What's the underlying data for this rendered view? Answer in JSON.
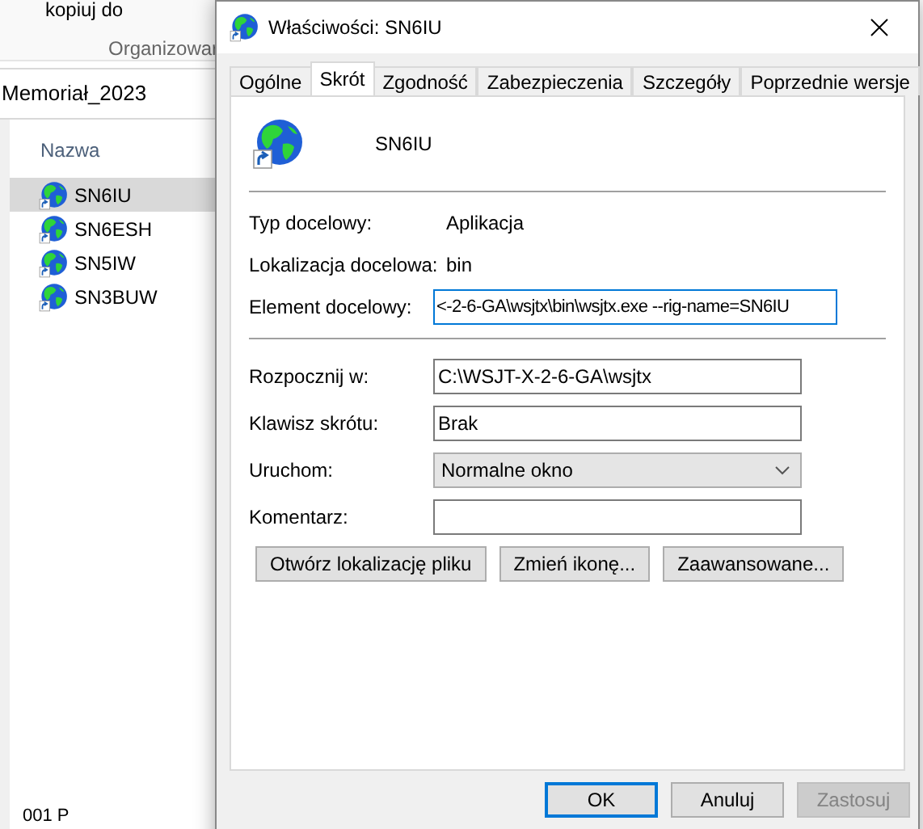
{
  "explorer": {
    "ribbon_button": "kopiuj do",
    "ribbon_group": "Organizowar",
    "path": "Memoriał_2023",
    "column": "Nazwa",
    "files": [
      {
        "name": "SN6IU",
        "selected": true
      },
      {
        "name": "SN6ESH",
        "selected": false
      },
      {
        "name": "SN5IW",
        "selected": false
      },
      {
        "name": "SN3BUW",
        "selected": false
      }
    ],
    "bottom_item": "001 P"
  },
  "dialog": {
    "title": "Właściwości: SN6IU",
    "tabs": [
      {
        "label": "Ogólne",
        "selected": false
      },
      {
        "label": "Skrót",
        "selected": true
      },
      {
        "label": "Zgodność",
        "selected": false
      },
      {
        "label": "Zabezpieczenia",
        "selected": false
      },
      {
        "label": "Szczegóły",
        "selected": false
      },
      {
        "label": "Poprzednie wersje",
        "selected": false
      }
    ],
    "shortcut_name": "SN6IU",
    "info_rows": [
      {
        "label": "Typ docelowy:",
        "value": "Aplikacja"
      },
      {
        "label": "Lokalizacja docelowa:",
        "value": "bin"
      }
    ],
    "target": {
      "label": "Element docelowy:",
      "value": "<-2-6-GA\\wsjtx\\bin\\wsjtx.exe --rig-name=SN6IU"
    },
    "fields": [
      {
        "kind": "text",
        "label": "Rozpocznij w:",
        "value": "C:\\WSJT-X-2-6-GA\\wsjtx"
      },
      {
        "kind": "text",
        "label": "Klawisz skrótu:",
        "value": "Brak"
      },
      {
        "kind": "select",
        "label": "Uruchom:",
        "value": "Normalne okno"
      },
      {
        "kind": "text",
        "label": "Komentarz:"
      }
    ],
    "action_buttons": [
      "Otwórz lokalizację pliku",
      "Zmień ikonę...",
      "Zaawansowane..."
    ],
    "footer_buttons": [
      {
        "label": "OK",
        "default": true,
        "disabled": false
      },
      {
        "label": "Anuluj",
        "default": false,
        "disabled": false
      },
      {
        "label": "Zastosuj",
        "default": false,
        "disabled": true
      }
    ]
  }
}
